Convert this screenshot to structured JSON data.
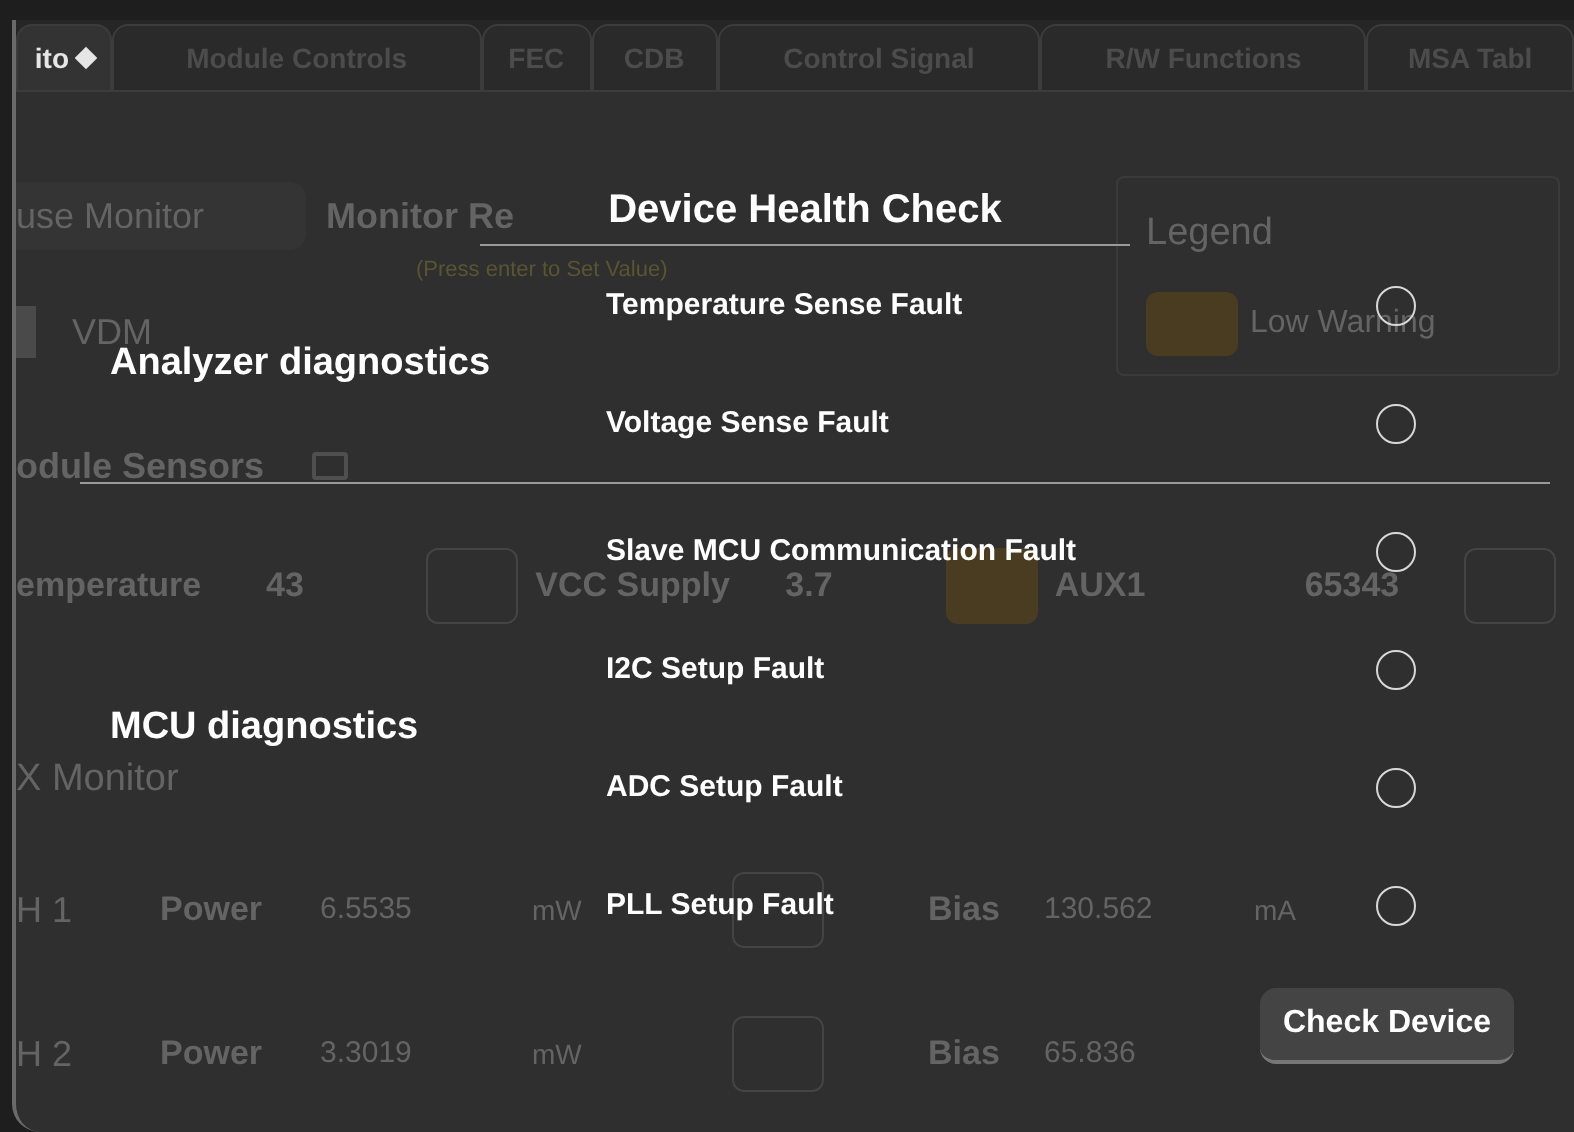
{
  "tabs": [
    {
      "label": "ito",
      "selected": true
    },
    {
      "label": "Module Controls",
      "selected": false
    },
    {
      "label": "FEC",
      "selected": false
    },
    {
      "label": "CDB",
      "selected": false
    },
    {
      "label": "Control Signal",
      "selected": false
    },
    {
      "label": "R/W Functions",
      "selected": false
    },
    {
      "label": "MSA Tabl",
      "selected": false
    }
  ],
  "background": {
    "subtab": "use Monitor",
    "subtab_2": "Monitor Re",
    "hint": "(Press enter to Set Value)",
    "vdm": "VDM",
    "legend": {
      "title": "Legend",
      "item": "Low Warning"
    },
    "module_sensors": "odule Sensors",
    "sensors": [
      {
        "label": "emperature",
        "value": "43",
        "warning": false
      },
      {
        "label": "VCC Supply",
        "value": "3.7",
        "warning": true
      },
      {
        "label": "AUX1",
        "value": "65343",
        "warning": false
      }
    ],
    "monitor": "X Monitor",
    "channels": [
      {
        "name": "H 1",
        "power_label": "Power",
        "power": "6.5535",
        "unit": "mW",
        "bias_label": "Bias",
        "bias": "130.562",
        "bias_unit": "mA"
      },
      {
        "name": "H 2",
        "power_label": "Power",
        "power": "3.3019",
        "unit": "mW",
        "bias_label": "Bias",
        "bias": "65.836"
      }
    ]
  },
  "dialog": {
    "title": "Device Health Check",
    "groups": [
      {
        "label": "Analyzer diagnostics",
        "faults": [
          {
            "label": "Temperature Sense Fault",
            "checked": false
          },
          {
            "label": "Voltage Sense Fault",
            "checked": false
          }
        ]
      },
      {
        "label": "MCU diagnostics",
        "faults": [
          {
            "label": "Slave MCU Communication Fault",
            "checked": false
          },
          {
            "label": "I2C Setup Fault",
            "checked": false
          },
          {
            "label": "ADC Setup Fault",
            "checked": false
          },
          {
            "label": "PLL Setup Fault",
            "checked": false
          }
        ]
      }
    ],
    "button": "Check Device"
  }
}
